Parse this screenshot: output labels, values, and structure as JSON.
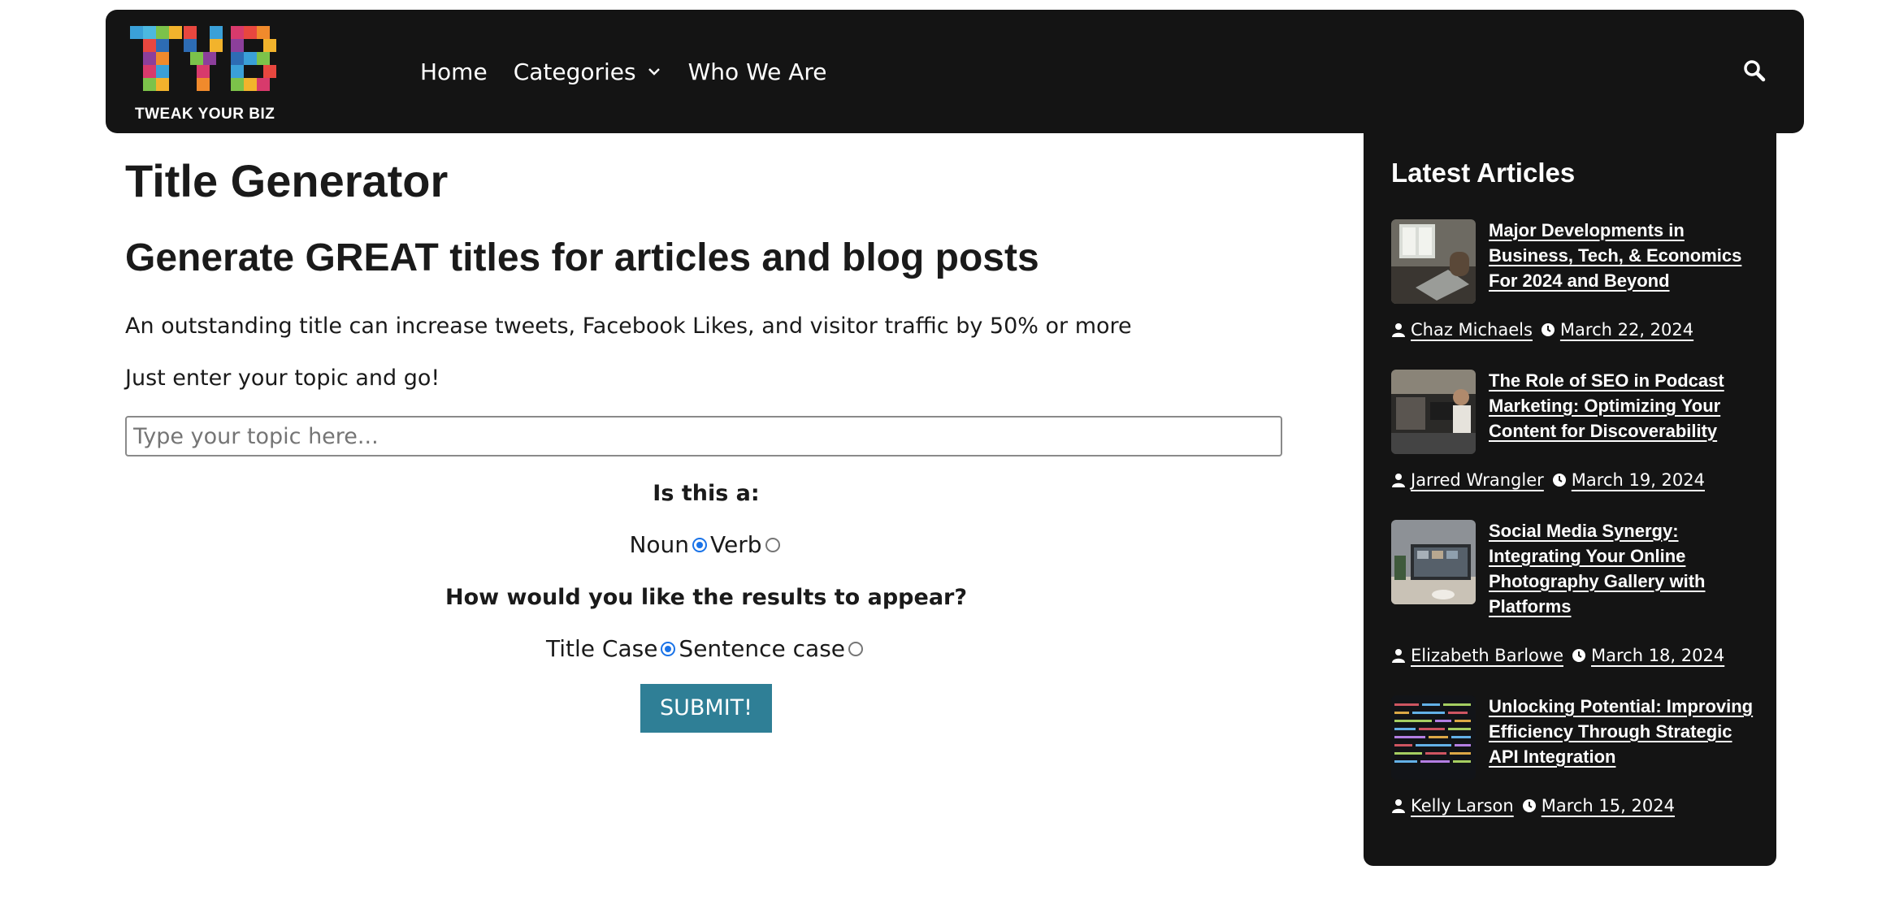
{
  "brand": {
    "logo_text": "TWEAK YOUR BIZ"
  },
  "nav": {
    "home": "Home",
    "categories": "Categories",
    "who_we_are": "Who We Are"
  },
  "main": {
    "title": "Title Generator",
    "subtitle": "Generate GREAT titles for articles and blog posts",
    "intro": "An outstanding title can increase tweets, Facebook Likes, and visitor traffic by 50% or more",
    "instruction": "Just enter your topic and go!",
    "topic_placeholder": "Type your topic here...",
    "question_type": "Is this a:",
    "option_noun": "Noun",
    "option_verb": "Verb",
    "question_case": "How would you like the results to appear?",
    "option_title_case": "Title Case",
    "option_sentence_case": "Sentence case",
    "submit_label": "SUBMIT!"
  },
  "sidebar": {
    "title": "Latest Articles",
    "articles": [
      {
        "title": "Major Developments in Business, Tech, & Economics For 2024 and Beyond",
        "author": "Chaz Michaels",
        "date": "March 22, 2024"
      },
      {
        "title": "The Role of SEO in Podcast Marketing: Optimizing Your Content for Discoverability",
        "author": "Jarred Wrangler",
        "date": "March 19, 2024"
      },
      {
        "title": "Social Media Synergy: Integrating Your Online Photography Gallery with Platforms",
        "author": "Elizabeth Barlowe",
        "date": "March 18, 2024"
      },
      {
        "title": "Unlocking Potential: Improving Efficiency Through Strategic API Integration",
        "author": "Kelly Larson",
        "date": "March 15, 2024"
      }
    ]
  },
  "colors": {
    "header_bg": "#141414",
    "submit_bg": "#2f7f96",
    "radio_checked": "#1a73e8"
  }
}
